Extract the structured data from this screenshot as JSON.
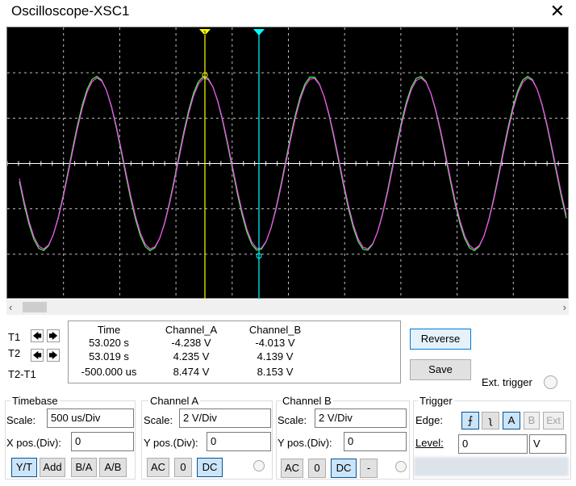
{
  "window": {
    "title": "Oscilloscope-XSC1",
    "close_glyph": "✕"
  },
  "colors": {
    "channel_a": "#ff40ff",
    "channel_b": "#40ff40",
    "cursor_1": "#ffff00",
    "cursor_2": "#00ffff",
    "grid": "#ffffff",
    "screen": "#000000"
  },
  "cursors": {
    "t1_label": "1",
    "t2_label": "2"
  },
  "scroll": {
    "left_glyph": "‹",
    "right_glyph": "›"
  },
  "readout": {
    "row_labels": [
      "T1",
      "T2",
      "T2-T1"
    ],
    "headers": [
      "Time",
      "Channel_A",
      "Channel_B"
    ],
    "rows": [
      [
        "53.020 s",
        "-4.238 V",
        "-4.013 V"
      ],
      [
        "53.019 s",
        "4.235 V",
        "4.139 V"
      ],
      [
        "-500.000 us",
        "8.474 V",
        "8.153 V"
      ]
    ],
    "left_arrow": "🡄",
    "right_arrow": "🡆"
  },
  "buttons": {
    "reverse": "Reverse",
    "save": "Save",
    "ext_trigger": "Ext. trigger"
  },
  "timebase": {
    "title": "Timebase",
    "scale_label": "Scale:",
    "scale_value": "500 us/Div",
    "xpos_label": "X pos.(Div):",
    "xpos_value": "0",
    "modes": [
      "Y/T",
      "Add",
      "B/A",
      "A/B"
    ]
  },
  "channel_a": {
    "title": "Channel A",
    "scale_label": "Scale:",
    "scale_value": "2  V/Div",
    "ypos_label": "Y pos.(Div):",
    "ypos_value": "0",
    "coupling": [
      "AC",
      "0",
      "DC"
    ]
  },
  "channel_b": {
    "title": "Channel B",
    "scale_label": "Scale:",
    "scale_value": "2  V/Div",
    "ypos_label": "Y pos.(Div):",
    "ypos_value": "0",
    "coupling": [
      "AC",
      "0",
      "DC",
      "-"
    ]
  },
  "trigger": {
    "title": "Trigger",
    "edge_label": "Edge:",
    "level_label": "Level:",
    "level_value": "0",
    "level_unit": "V",
    "sources": [
      "A",
      "B",
      "Ext"
    ],
    "rising_glyph": "⨍",
    "falling_glyph": "ʅ"
  }
}
